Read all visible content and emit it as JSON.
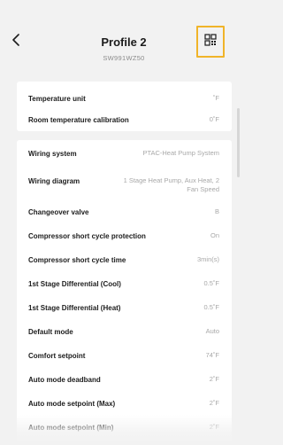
{
  "header": {
    "title": "Profile 2",
    "subtitle": "SW991WZ50",
    "back_icon": "chevron-left-icon",
    "qr_icon": "qr-code-icon",
    "accent_color": "#f0b429"
  },
  "card1": {
    "rows": [
      {
        "label": "Temperature unit",
        "value": "˚F"
      },
      {
        "label": "Room temperature calibration",
        "value": "0˚F"
      }
    ]
  },
  "card2": {
    "rows": [
      {
        "label": "Wiring system",
        "value": "PTAC-Heat Pump System"
      },
      {
        "label": "Wiring diagram",
        "value": "1 Stage Heat Pump, Aux Heat, 2 Fan Speed"
      },
      {
        "label": "Changeover valve",
        "value": "B"
      },
      {
        "label": "Compressor short cycle protection",
        "value": "On"
      },
      {
        "label": "Compressor short cycle time",
        "value": "3min(s)"
      },
      {
        "label": "1st Stage Differential (Cool)",
        "value": "0.5˚F"
      },
      {
        "label": "1st Stage Differential (Heat)",
        "value": "0.5˚F"
      },
      {
        "label": "Default mode",
        "value": "Auto"
      },
      {
        "label": "Comfort setpoint",
        "value": "74˚F"
      },
      {
        "label": "Auto mode deadband",
        "value": "2˚F"
      },
      {
        "label": "Auto mode setpoint (Max)",
        "value": "2˚F"
      },
      {
        "label": "Auto mode setpoint (Min)",
        "value": "2˚F"
      }
    ]
  }
}
